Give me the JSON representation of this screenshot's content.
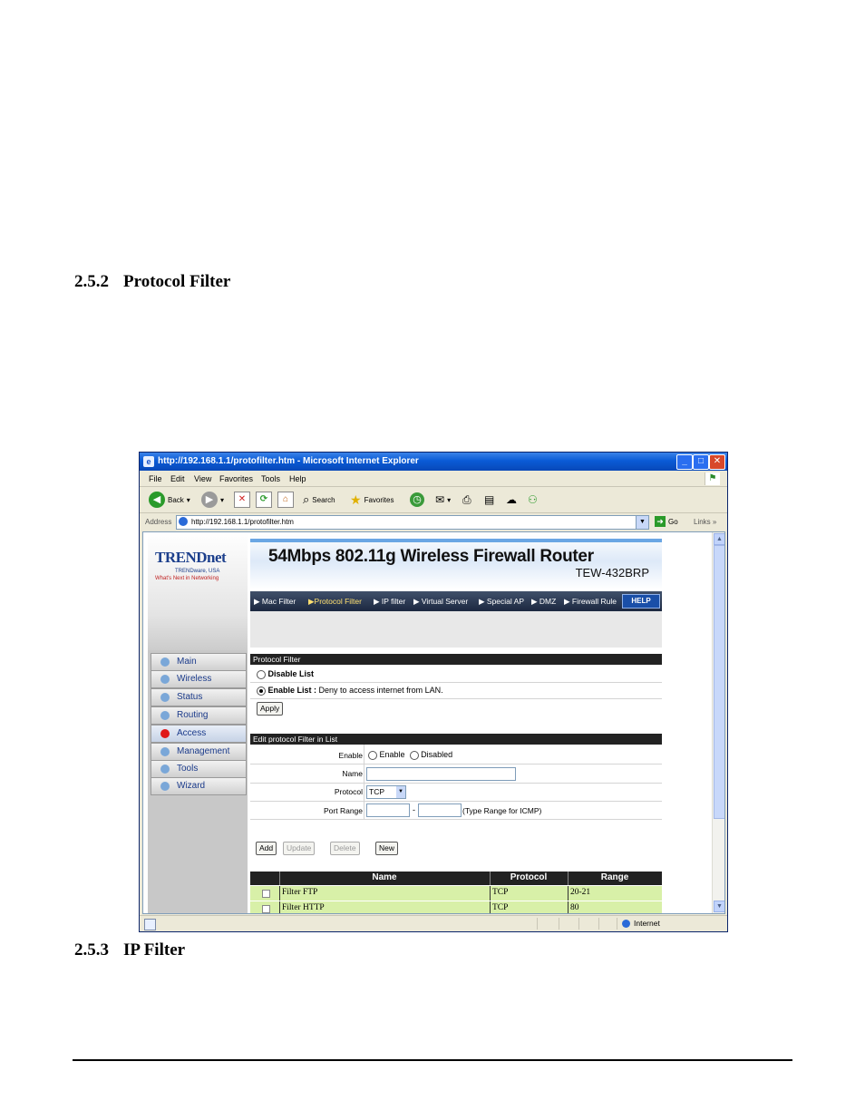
{
  "headings": [
    {
      "number": "2.5.2",
      "title": "Protocol Filter"
    },
    {
      "number": "2.5.3",
      "title": "IP Filter"
    }
  ],
  "window": {
    "title": "http://192.168.1.1/protofilter.htm - Microsoft Internet Explorer",
    "menu": [
      "File",
      "Edit",
      "View",
      "Favorites",
      "Tools",
      "Help"
    ],
    "toolbar": {
      "back": "Back",
      "search": "Search",
      "favorites": "Favorites"
    },
    "address_label": "Address",
    "address": "http://192.168.1.1/protofilter.htm",
    "go": "Go",
    "links": "Links",
    "status_zone": "Internet"
  },
  "router": {
    "logo": "TRENDnet",
    "logo_sub1": "TRENDware, USA",
    "logo_sub2": "What's Next in Networking",
    "banner_title": "54Mbps 802.11g Wireless Firewall Router",
    "banner_model": "TEW-432BRP",
    "nav": [
      "Main",
      "Wireless",
      "Status",
      "Routing",
      "Access",
      "Management",
      "Tools",
      "Wizard"
    ],
    "active_nav": "Access",
    "subnav": [
      "Mac Filter",
      "Protocol Filter",
      "IP filter",
      "Virtual Server",
      "Special AP",
      "DMZ",
      "Firewall Rule"
    ],
    "help": "HELP"
  },
  "protocol_filter": {
    "header": "Protocol Filter",
    "disable_label": "Disable List",
    "enable_label": "Enable List :",
    "enable_desc": "Deny to access internet from LAN.",
    "apply": "Apply"
  },
  "edit_form": {
    "header": "Edit protocol Filter in List",
    "enable_label": "Enable",
    "enable_opt": "Enable",
    "disabled_opt": "Disabled",
    "name_label": "Name",
    "protocol_label": "Protocol",
    "protocol_value": "TCP",
    "port_label": "Port Range",
    "port_sep": "-",
    "port_hint": "(Type Range for ICMP)",
    "buttons": {
      "add": "Add",
      "update": "Update",
      "delete": "Delete",
      "new": "New"
    }
  },
  "filter_table": {
    "columns": [
      "Name",
      "Protocol",
      "Range"
    ],
    "rows": [
      {
        "name": "Filter FTP",
        "protocol": "TCP",
        "range": "20-21"
      },
      {
        "name": "Filter HTTP",
        "protocol": "TCP",
        "range": "80"
      }
    ]
  }
}
